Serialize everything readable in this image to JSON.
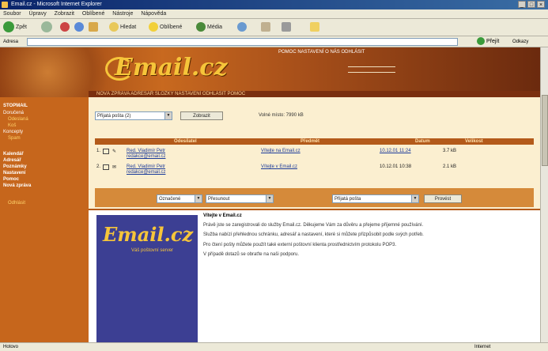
{
  "window": {
    "title": "Email.cz - Microsoft Internet Explorer"
  },
  "menu": [
    "Soubor",
    "Úpravy",
    "Zobrazit",
    "Oblíbené",
    "Nástroje",
    "Nápověda"
  ],
  "toolbar": {
    "back": "Zpět",
    "search": "Hledat",
    "favorites": "Oblíbené",
    "media": "Média"
  },
  "address": {
    "label": "Adresa",
    "go": "Přejít",
    "links": "Odkazy"
  },
  "banner": {
    "logo": "Email.cz",
    "top_links": "POMOC  NASTAVENÍ  O NÁS  ODHLÁSIT",
    "nav": "NOVÁ ZPRÁVA  ADRESÁŘ  SLOŽKY  NASTAVENÍ  ODHLÁSIT  POMOC"
  },
  "sidebar": {
    "head": "STOPMAIL",
    "items": [
      "Doručená",
      "Odeslaná",
      "Koš",
      "Koncepty",
      "Spam"
    ],
    "links": [
      "Kalendář",
      "Adresář",
      "Poznámky",
      "Nastavení",
      "Pomoc",
      "Nová zpráva"
    ],
    "bottom": "Odhlásit"
  },
  "filter": {
    "folder_select": "Přijatá pošta (2)",
    "show_button": "Zobrazit",
    "free_info": "Volné místo: 7990 kB"
  },
  "table": {
    "headers": [
      "Odesílatel",
      "Předmět",
      "Datum",
      "Velikost"
    ],
    "rows": [
      {
        "num": "1.",
        "from": "Red. Vladimír Petr",
        "from2": "redakce@email.cz",
        "subject": "Vítejte na Email.cz",
        "date": "10.12.01 11:24",
        "size": "3.7 kB"
      },
      {
        "num": "2.",
        "from": "Red. Vladimír Petr",
        "from2": "redakce@email.cz",
        "subject": "Vítejte v Email.cz",
        "date": "10.12.01 10:38",
        "size": "2.1 kB"
      }
    ]
  },
  "actions": {
    "sel1": "Označené",
    "sel2": "Přesunout",
    "sel3": "Přijatá pošta",
    "button": "Provést"
  },
  "preview": {
    "logo": "Email.cz",
    "logo_sub": "Váš poštovní server",
    "title": "Vítejte v Email.cz",
    "paragraphs": [
      "Právě jste se zaregistrovali do služby Email.cz. Děkujeme Vám za důvěru a přejeme příjemné používání.",
      "Služba nabízí přehlednou schránku, adresář a nastavení, které si můžete přizpůsobit podle svých potřeb.",
      "Pro čtení pošty můžete použít také externí poštovní klienta prostřednictvím protokolu POP3.",
      "V případě dotazů se obraťte na naši podporu."
    ]
  },
  "status": {
    "text": "Hotovo",
    "zone": "Internet"
  }
}
